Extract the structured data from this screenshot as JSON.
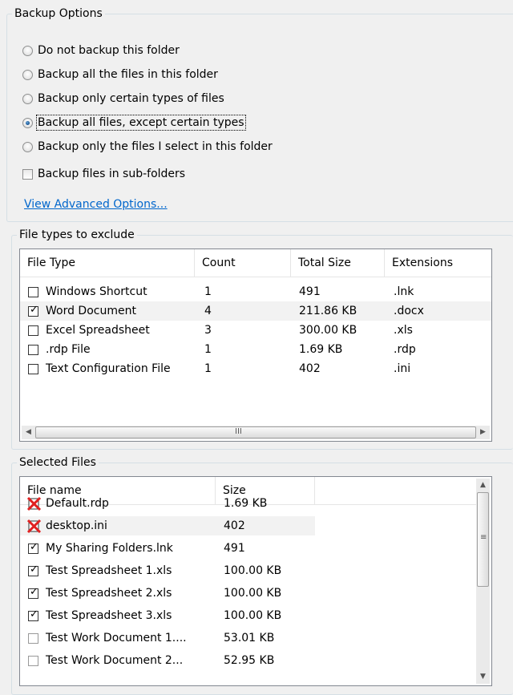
{
  "backup_options": {
    "title": "Backup Options",
    "radios": [
      {
        "label": "Do not backup this folder",
        "checked": false
      },
      {
        "label": "Backup all the files in this folder",
        "checked": false
      },
      {
        "label": "Backup only certain types of files",
        "checked": false
      },
      {
        "label": "Backup all files, except certain types",
        "checked": true
      },
      {
        "label": "Backup only the files I select in this folder",
        "checked": false
      }
    ],
    "subfolders_label": "Backup files in sub-folders",
    "subfolders_checked": false,
    "advanced_link": "View Advanced Options..."
  },
  "file_types": {
    "title": "File types to exclude",
    "columns": [
      "File Type",
      "Count",
      "Total Size",
      "Extensions"
    ],
    "rows": [
      {
        "type": "Windows Shortcut",
        "count": "1",
        "size": "491",
        "ext": ".lnk",
        "checked": false
      },
      {
        "type": "Word Document",
        "count": "4",
        "size": "211.86 KB",
        "ext": ".docx",
        "checked": true
      },
      {
        "type": "Excel Spreadsheet",
        "count": "3",
        "size": "300.00 KB",
        "ext": ".xls",
        "checked": false
      },
      {
        "type": ".rdp File",
        "count": "1",
        "size": "1.69 KB",
        "ext": ".rdp",
        "checked": false
      },
      {
        "type": "Text Configuration File",
        "count": "1",
        "size": "402",
        "ext": ".ini",
        "checked": false
      }
    ]
  },
  "selected_files": {
    "title": "Selected Files",
    "columns": [
      "File name",
      "Size"
    ],
    "rows": [
      {
        "name": "Default.rdp",
        "size": "1.69 KB",
        "state": "excluded"
      },
      {
        "name": "desktop.ini",
        "size": "402",
        "state": "excluded"
      },
      {
        "name": "My Sharing Folders.lnk",
        "size": "491",
        "state": "checked"
      },
      {
        "name": "Test Spreadsheet 1.xls",
        "size": "100.00 KB",
        "state": "checked"
      },
      {
        "name": "Test Spreadsheet 2.xls",
        "size": "100.00 KB",
        "state": "checked"
      },
      {
        "name": "Test Spreadsheet 3.xls",
        "size": "100.00 KB",
        "state": "checked"
      },
      {
        "name": "Test Work Document 1....",
        "size": "53.01 KB",
        "state": "unchecked"
      },
      {
        "name": "Test Work Document 2...",
        "size": "52.95 KB",
        "state": "unchecked"
      }
    ]
  },
  "scroll_glyphs": {
    "left": "◀",
    "right": "▶",
    "up": "▲",
    "down": "▼",
    "grip_h": "III",
    "grip_v": "≡"
  },
  "colors": {
    "link": "#0066cc",
    "checked_radio": "#1d5a99",
    "excluded_mark": "#e02020"
  },
  "icons": [
    "radio-button",
    "checkbox",
    "check-mark",
    "excluded-mark-icon",
    "scroll-arrow-icon"
  ]
}
